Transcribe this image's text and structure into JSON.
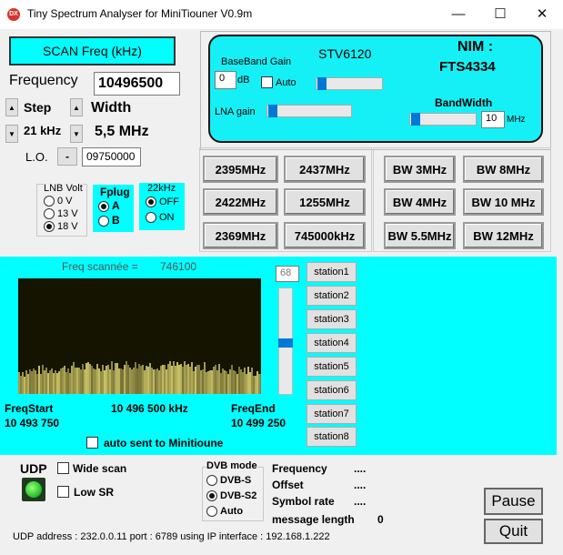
{
  "window": {
    "title": "Tiny Spectrum Analyser for MiniTiouner V0.9m",
    "app_icon_text": "DX",
    "minimize": "—",
    "maximize": "☐",
    "close": "✕"
  },
  "scan": {
    "button": "SCAN Freq (kHz)",
    "frequency_label": "Frequency",
    "frequency_value": "10496500",
    "step_label": "Step",
    "step_value": "21 kHz",
    "width_label": "Width",
    "width_value": "5,5 MHz",
    "lo_label": "L.O.",
    "lo_minus": "-",
    "lo_value": "09750000"
  },
  "lnb": {
    "title": "LNB Volt",
    "options": [
      "0 V",
      "13 V",
      "18 V"
    ],
    "selected": "18 V"
  },
  "fplug": {
    "title": "Fplug",
    "options": [
      "A",
      "B"
    ],
    "selected": "A"
  },
  "khz22": {
    "title": "22kHz",
    "options": [
      "OFF",
      "ON"
    ],
    "selected": "OFF"
  },
  "tuner": {
    "baseband_gain_label": "BaseBand Gain",
    "baseband_gain_value": "0",
    "db_label": "dB",
    "auto_label": "Auto",
    "chip": "STV6120",
    "nim_label": "NIM :",
    "nim_value": "FTS4334",
    "lna_gain_label": "LNA gain",
    "bandwidth_label": "BandWidth",
    "bandwidth_value": "10",
    "mhz_label": "MHz"
  },
  "freq_presets": [
    "2395MHz",
    "2437MHz",
    "2422MHz",
    "1255MHz",
    "2369MHz",
    "745000kHz"
  ],
  "bw_presets": [
    "BW 3MHz",
    "BW 8MHz",
    "BW 4MHz",
    "BW 10 MHz",
    "BW 5.5MHz",
    "BW 12MHz"
  ],
  "spectrum": {
    "freq_scanned_label": "Freq scannée =",
    "freq_scanned_value": "746100",
    "level_value": "68",
    "freq_start_label": "FreqStart",
    "freq_start_value": "10 493 750",
    "center_value": "10 496 500 kHz",
    "freq_end_label": "FreqEnd",
    "freq_end_value": "10 499 250",
    "auto_sent_label": "auto sent to Minitioune",
    "stations": [
      "station1",
      "station2",
      "station3",
      "station4",
      "station5",
      "station6",
      "station7",
      "station8"
    ]
  },
  "bottom": {
    "udp_label": "UDP",
    "wide_scan_label": "Wide scan",
    "low_sr_label": "Low SR",
    "dvb_mode_title": "DVB mode",
    "dvb_options": [
      "DVB-S",
      "DVB-S2",
      "Auto"
    ],
    "dvb_selected": "DVB-S2",
    "frequency_label": "Frequency",
    "frequency_value": "....",
    "offset_label": "Offset",
    "offset_value": "....",
    "symbol_rate_label": "Symbol rate",
    "symbol_rate_value": "....",
    "message_length_label": "message length",
    "message_length_value": "0",
    "pause_button": "Pause",
    "quit_button": "Quit",
    "udp_address_text": "UDP address : 232.0.0.11 port : 6789 using IP interface : 192.168.1.222"
  },
  "colors": {
    "panel_cyan": "#00ffff",
    "spectrum_bg": "#141400",
    "spectrum_trace": "#c8c064",
    "udp_led": "#33cc33",
    "slider_thumb": "#0078d7"
  }
}
